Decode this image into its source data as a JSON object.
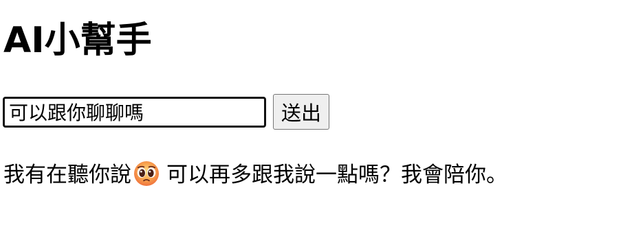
{
  "header": {
    "title": "AI小幫手"
  },
  "chat_form": {
    "input_value": "可以跟你聊聊嗎",
    "send_label": "送出"
  },
  "response": {
    "text_before_emoji": "我有在聽你說",
    "emoji_icon": "pleading-face-icon",
    "text_after_emoji": "可以再多跟我說一點嗎？我會陪你。"
  },
  "colors": {
    "text": "#000000",
    "button_background": "#efefef",
    "input_border": "#111111"
  }
}
